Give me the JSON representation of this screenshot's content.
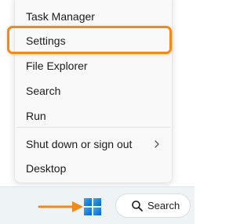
{
  "menu": {
    "items": [
      {
        "label": "Task Manager"
      },
      {
        "label": "Settings"
      },
      {
        "label": "File Explorer"
      },
      {
        "label": "Search"
      },
      {
        "label": "Run"
      },
      {
        "label": "Shut down or sign out"
      },
      {
        "label": "Desktop"
      }
    ],
    "highlighted_item": "Settings"
  },
  "taskbar": {
    "search_label": "Search"
  },
  "icons": {
    "start": "windows-logo-icon",
    "search": "search-icon",
    "submenu": "chevron-right-icon"
  },
  "colors": {
    "highlight": "#f08a1c",
    "windows_blue": "#1478dc"
  }
}
